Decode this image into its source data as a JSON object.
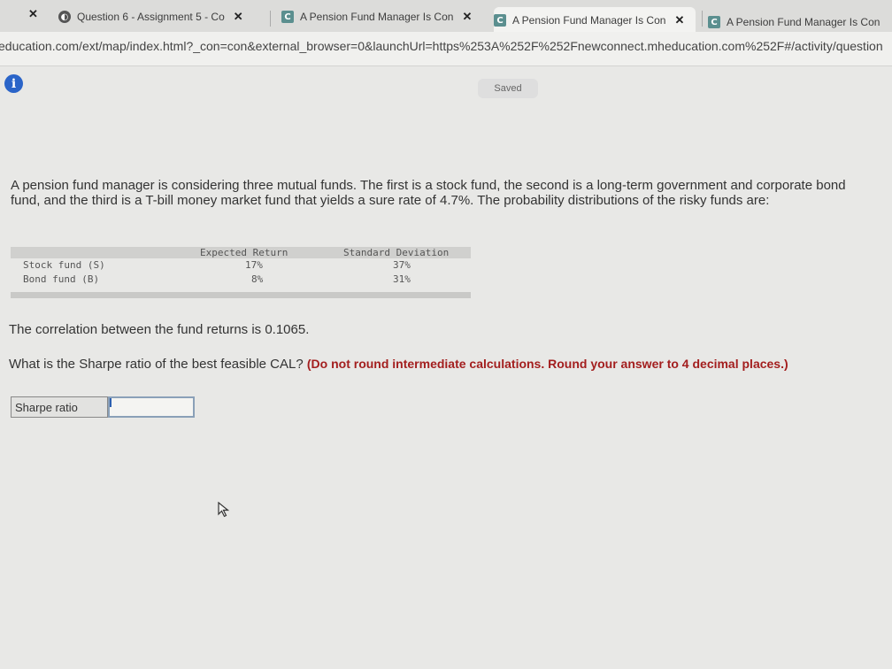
{
  "browser": {
    "tabs": [
      {
        "label": "Question 6 - Assignment 5 - Co",
        "favicon": "circle-logo-icon"
      },
      {
        "label": "A Pension Fund Manager Is Con",
        "favicon": "c-logo-icon"
      },
      {
        "label": "A Pension Fund Manager Is Con",
        "favicon": "c-logo-icon"
      },
      {
        "label": "A Pension Fund Manager Is Con",
        "favicon": "c-logo-icon"
      }
    ],
    "tab_close_glyph": "✕",
    "url": "education.com/ext/map/index.html?_con=con&external_browser=0&launchUrl=https%253A%252F%252Fnewconnect.mheducation.com%252F#/activity/question"
  },
  "status": {
    "saved_label": "Saved"
  },
  "question": {
    "intro": "A pension fund manager is considering three mutual funds. The first is a stock fund, the second is a long-term government and corporate bond fund, and the third is a T-bill money market fund that yields a sure rate of 4.7%. The probability distributions of the risky funds are:",
    "table": {
      "headers": [
        "Expected Return",
        "Standard Deviation"
      ],
      "rows": [
        {
          "name": "Stock fund (S)",
          "expected_return": "17%",
          "std_dev": "37%"
        },
        {
          "name": "Bond fund (B)",
          "expected_return": "8%",
          "std_dev": "31%"
        }
      ]
    },
    "correlation_text": "The correlation between the fund returns is 0.1065.",
    "prompt": "What is the Sharpe ratio of the best feasible CAL?",
    "instruction": "(Do not round intermediate calculations. Round your answer to 4 decimal places.)"
  },
  "answer": {
    "label": "Sharpe ratio",
    "value": ""
  },
  "colors": {
    "info": "#2a64c8",
    "instruction": "#a31e1e"
  }
}
